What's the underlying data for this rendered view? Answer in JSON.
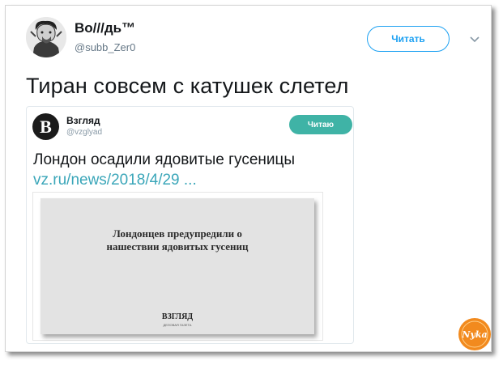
{
  "tweet": {
    "display_name": "Во///дь™",
    "handle": "@subb_Zer0",
    "follow_label": "Читать",
    "text": "Тиран совсем с катушек слетел"
  },
  "quoted": {
    "avatar_letter": "В",
    "name": "Взгляд",
    "handle": "@vzglyad",
    "follow_label": "Читаю",
    "text": "Лондон осадили ядовитые гусеницы",
    "link": "vz.ru/news/2018/4/29 ..."
  },
  "media": {
    "headline_line1": "Лондонцев предупредили о",
    "headline_line2": "нашествии ядовитых гусениц",
    "brand": "ВЗГЛЯД",
    "brand_sub": "ДЕЛОВАЯ ГАЗЕТА"
  },
  "watermark": {
    "text": "Nyka"
  },
  "colors": {
    "accent_blue": "#1da1f2",
    "teal_button": "#3fb3a6",
    "link": "#3aa6b9",
    "watermark": "#f28a1e"
  },
  "icons": {
    "more_menu": "chevron-down-icon",
    "avatar": "portrait-icon"
  }
}
